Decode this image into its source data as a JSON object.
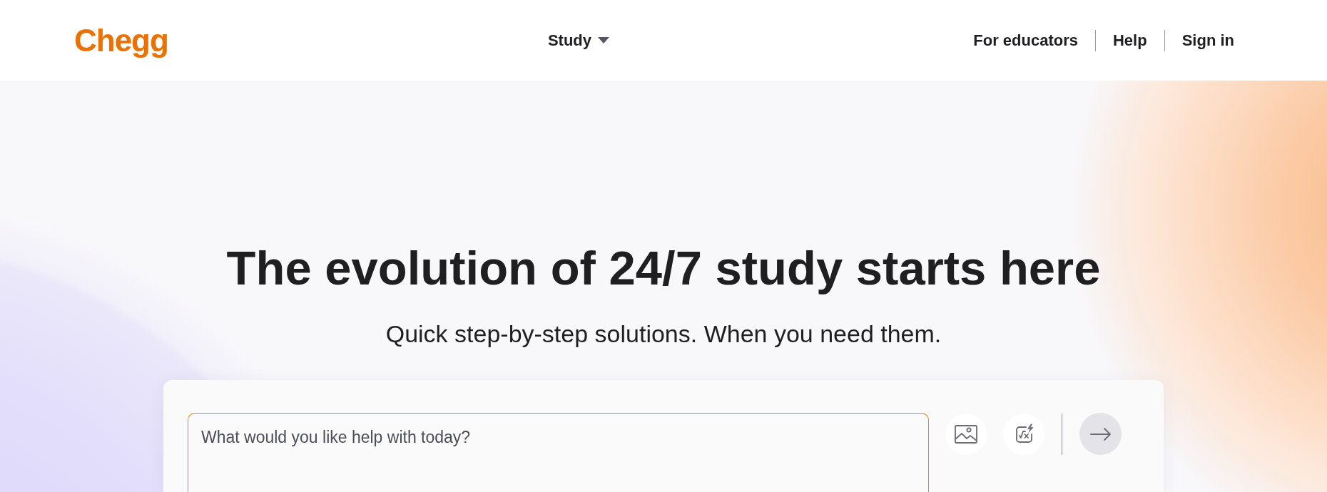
{
  "header": {
    "logo": "Chegg",
    "nav_center": [
      {
        "label": "Study",
        "kind": "dropdown"
      }
    ],
    "nav_right": [
      {
        "label": "For educators"
      },
      {
        "label": "Help"
      },
      {
        "label": "Sign in"
      }
    ]
  },
  "hero": {
    "title": "The evolution of 24/7 study starts here",
    "subtitle": "Quick step-by-step solutions. When you need them."
  },
  "question_box": {
    "placeholder": "What would you like help with today?",
    "tools": [
      {
        "kind": "image"
      },
      {
        "kind": "math"
      }
    ],
    "send_button": {
      "disabled": true
    }
  }
}
